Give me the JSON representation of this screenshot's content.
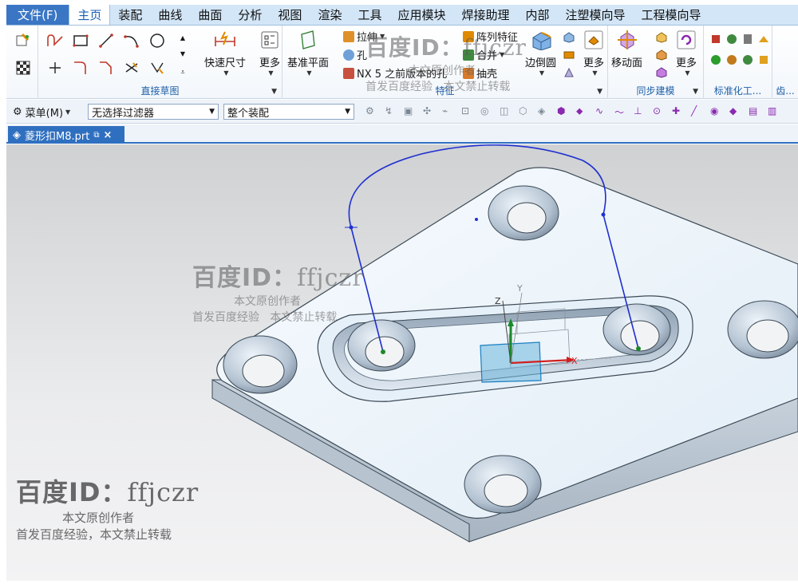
{
  "menu": {
    "file": "文件(F)",
    "tabs": [
      "主页",
      "装配",
      "曲线",
      "曲面",
      "分析",
      "视图",
      "渲染",
      "工具",
      "应用模块",
      "焊接助理",
      "内部",
      "注塑模向导",
      "工程模向导"
    ],
    "active_index": 0
  },
  "ribbon": {
    "sketch_group": {
      "label": "直接草图"
    },
    "quick_dim": "快速尺寸",
    "more_1": "更多",
    "datum_plane": "基准平面",
    "feature": {
      "label": "特征",
      "extrude": "拉伸",
      "hole": "孔",
      "nx5_hole": "NX 5 之前版本的孔",
      "pattern": "阵列特征",
      "unite": "合并",
      "shell": "抽壳",
      "edge_blend": "边倒圆",
      "more": "更多"
    },
    "sync": {
      "label": "同步建模",
      "move_face": "移动面",
      "more": "更多"
    },
    "standard": {
      "label": "标准化工..."
    },
    "gear": {
      "label": "齿..."
    }
  },
  "selection_bar": {
    "menu": "菜单(M)",
    "filter": "无选择过滤器",
    "scope": "整个装配"
  },
  "document": {
    "tab": "菱形扣M8.prt"
  },
  "viewport": {
    "axis_labels": {
      "x": "X",
      "y": "Y",
      "z": "Z"
    }
  },
  "watermark": {
    "id_prefix": "百度ID：",
    "user": "ffjczr",
    "line1": "本文原创作者",
    "line2": "首发百度经验",
    "line3": "本文禁止转载",
    "line_joined": "首发百度经验，本文禁止转载"
  },
  "colors": {
    "accent": "#2f6fbf",
    "curve": "#1f2fd0",
    "part_top": "#e9f3fa",
    "part_side": "#b9c6d2"
  }
}
